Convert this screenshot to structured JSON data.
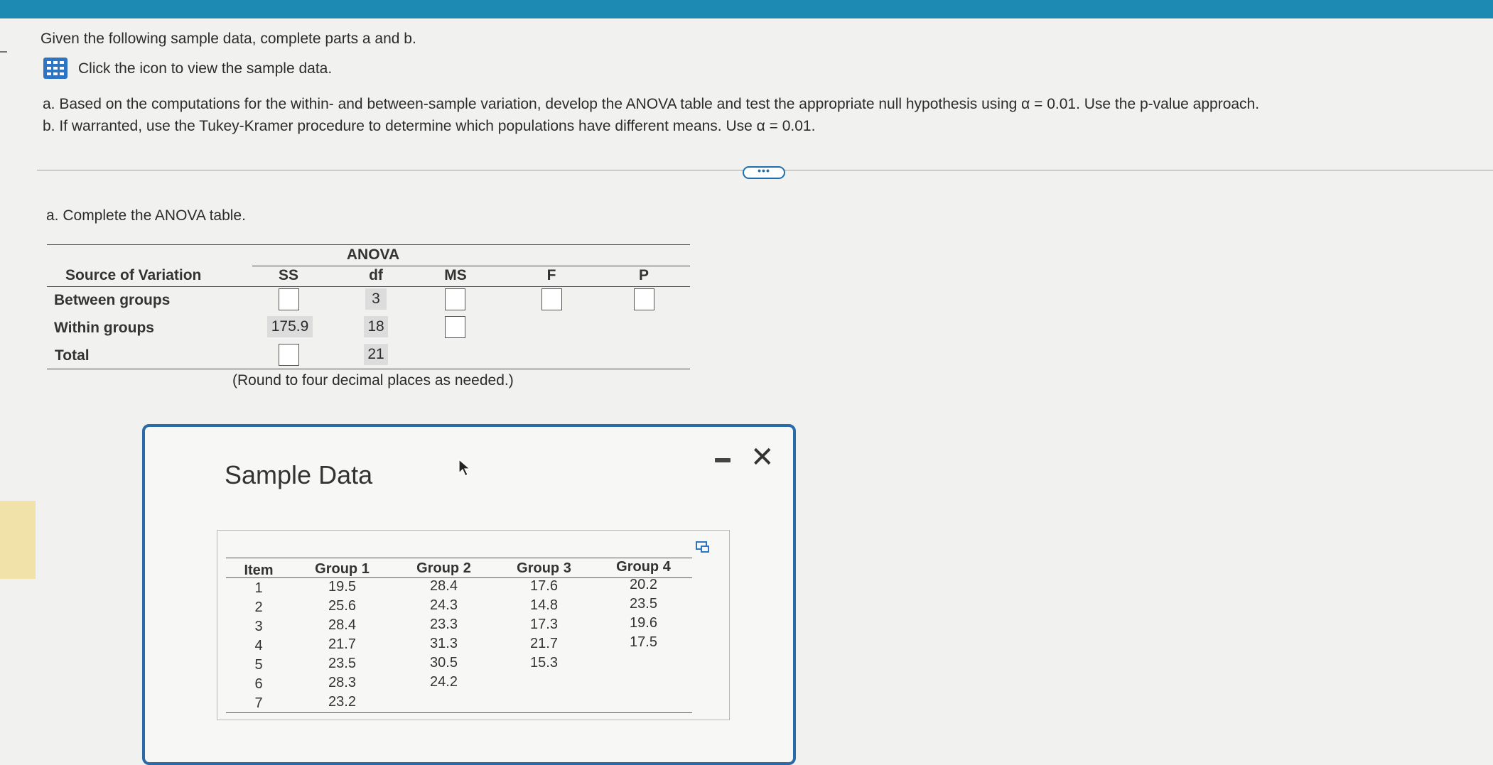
{
  "question": {
    "intro": "Given the following sample data, complete parts a and b.",
    "icon_hint": "Click the icon to view the sample data.",
    "part_a": "a. Based on the computations for the within- and between-sample variation, develop the ANOVA table and test the appropriate null hypothesis using α = 0.01. Use the p-value approach.",
    "part_b": "b. If warranted, use the Tukey-Kramer procedure to determine which populations have different means. Use α = 0.01.",
    "more_label": "•••"
  },
  "anova": {
    "instruction": "a. Complete the ANOVA table.",
    "title": "ANOVA",
    "headers": {
      "source": "Source of Variation",
      "ss": "SS",
      "df": "df",
      "ms": "MS",
      "f": "F",
      "p": "P"
    },
    "rows": [
      {
        "label": "Between groups",
        "ss": "",
        "df": "3",
        "ms": "",
        "f": "",
        "p": ""
      },
      {
        "label": "Within groups",
        "ss": "175.9",
        "df": "18",
        "ms": ""
      },
      {
        "label": "Total",
        "ss": "",
        "df": "21"
      }
    ],
    "note": "(Round to four decimal places as needed.)"
  },
  "dialog": {
    "title": "Sample Data",
    "columns": [
      "Item",
      "Group 1",
      "Group 2",
      "Group 3",
      "Group 4"
    ],
    "items": [
      "1",
      "2",
      "3",
      "4",
      "5",
      "6",
      "7"
    ],
    "group1": [
      "19.5",
      "25.6",
      "28.4",
      "21.7",
      "23.5",
      "28.3",
      "23.2"
    ],
    "group2": [
      "28.4",
      "24.3",
      "23.3",
      "31.3",
      "30.5",
      "24.2"
    ],
    "group3": [
      "17.6",
      "14.8",
      "17.3",
      "21.7",
      "15.3"
    ],
    "group4": [
      "20.2",
      "23.5",
      "19.6",
      "17.5"
    ],
    "close_symbol": "✕"
  },
  "icons": {
    "data_table": "grid-table-icon",
    "minimize": "minimize-icon",
    "close": "close-icon",
    "copy": "copy-icon",
    "cursor": "mouse-cursor-icon"
  },
  "colors": {
    "topbar": "#1d8ab3",
    "accent": "#2d74c4",
    "dialog_border": "#2a6aa6"
  }
}
